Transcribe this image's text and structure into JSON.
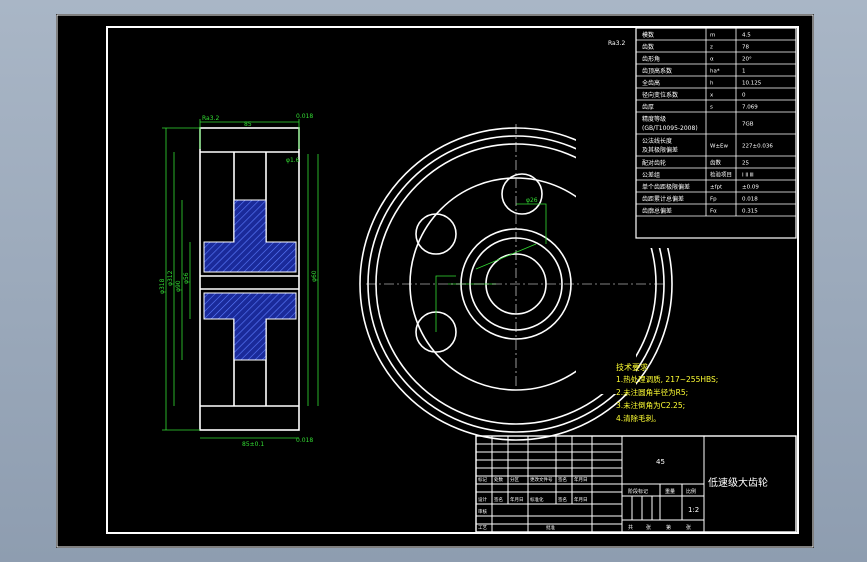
{
  "colors": {
    "frame": "#ffffff",
    "dimension": "#33dd33",
    "notes": "#ffff33",
    "hatch": "#2233cc",
    "background": "#000000"
  },
  "corner_label": "Ra3.2",
  "param_table": [
    {
      "name": "模数",
      "symbol": "m",
      "value": "4.5"
    },
    {
      "name": "齿数",
      "symbol": "z",
      "value": "78"
    },
    {
      "name": "齿形角",
      "symbol": "α",
      "value": "20°"
    },
    {
      "name": "齿顶高系数",
      "symbol": "ha*",
      "value": "1"
    },
    {
      "name": "全齿高",
      "symbol": "h",
      "value": "10.125"
    },
    {
      "name": "径向变位系数",
      "symbol": "x",
      "value": "0"
    },
    {
      "name": "齿厚",
      "symbol": "s",
      "value": "7.069"
    },
    {
      "name": "精度等级\n(GB/T10095-2008)",
      "symbol": "",
      "value": "7GB"
    },
    {
      "name": "公法线长度\n及其极限偏差",
      "symbol": "W±Ew",
      "value": "227±0.036"
    },
    {
      "name": "配对齿轮",
      "symbol": "齿数",
      "value": "25"
    },
    {
      "name": "公差组",
      "symbol": "检验项目",
      "value": "Ⅰ  Ⅱ  Ⅲ"
    },
    {
      "name": "单个齿距极限偏差",
      "symbol": "±fpt",
      "value": "±0.09"
    },
    {
      "name": "齿距累计总偏差",
      "symbol": "Fp",
      "value": "0.018"
    },
    {
      "name": "齿廓总偏差",
      "symbol": "Fα",
      "value": "0.315"
    }
  ],
  "tech_notes": {
    "title": "技术要求",
    "items": [
      "1.热处理调质, 217~255HBS;",
      "2.未注圆角半径为R5;",
      "3.未注倒角为C2.25;",
      "4.清除毛刺。"
    ]
  },
  "title_block": {
    "part_name": "低速级大齿轮",
    "material": "45",
    "scale": "1:2",
    "row_labels": [
      "标记",
      "处数",
      "分区",
      "更改文件号",
      "签名",
      "年月日"
    ],
    "sign_labels": [
      "设计",
      "签名",
      "年月日",
      "标准化",
      "签名",
      "年月日"
    ],
    "side_labels": [
      "审核",
      "工艺",
      "批准"
    ],
    "stage_labels": [
      "阶段标记",
      "重量",
      "比例"
    ],
    "sheet_labels": [
      "共",
      "张",
      "第",
      "张"
    ]
  },
  "section_view": {
    "roughness": "Ra3.2",
    "dims_left": [
      "φ318",
      "φ312",
      "φ90",
      "φ56"
    ],
    "dims_right": [
      "φ1.6",
      "φ60"
    ],
    "width_top": "85",
    "width_bottom": "85±0.1",
    "tol_top": "0.018",
    "tol_bottom": "0.018"
  },
  "front_view": {
    "dim_label": "φ26"
  }
}
